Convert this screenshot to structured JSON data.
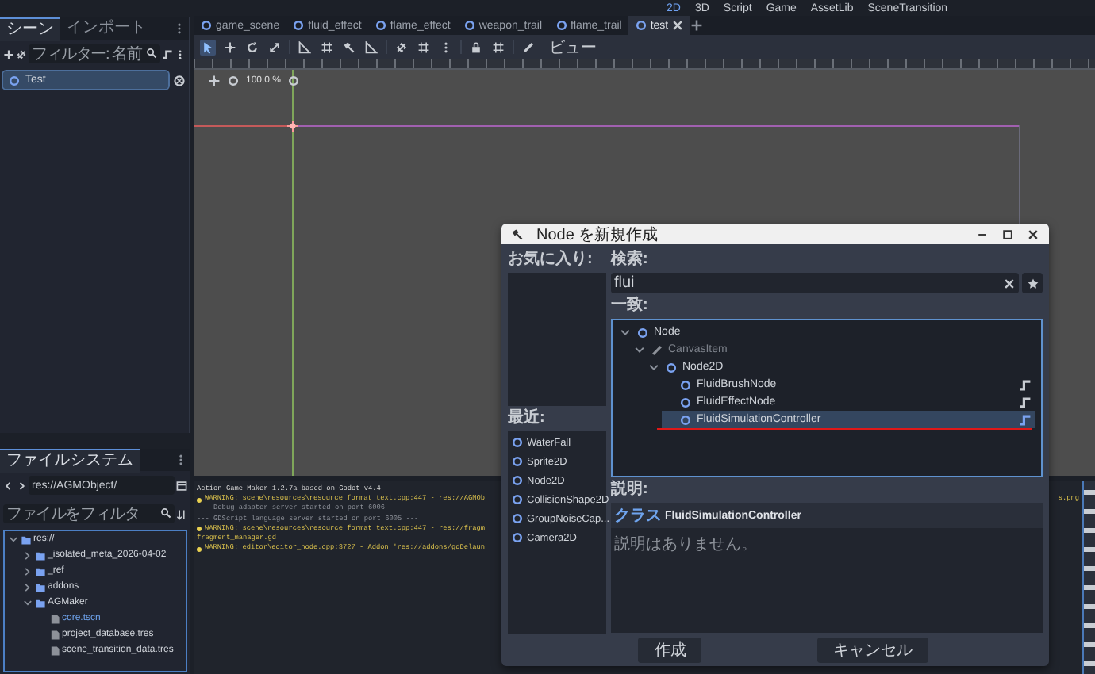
{
  "top_bar": {
    "workspaces": [
      {
        "label": "2D",
        "selected": true
      },
      {
        "label": "3D",
        "selected": false
      },
      {
        "label": "Script",
        "selected": false
      },
      {
        "label": "Game",
        "selected": false
      },
      {
        "label": "AssetLib",
        "selected": false
      },
      {
        "label": "SceneTransition",
        "selected": false
      }
    ]
  },
  "scene_dock": {
    "tabs": [
      {
        "label": "シーン",
        "selected": true
      },
      {
        "label": "インポート",
        "selected": false
      }
    ],
    "filter": {
      "placeholder": "フィルター: 名前"
    },
    "tree": [
      {
        "label": "Test",
        "selected": true
      }
    ]
  },
  "filesystem_dock": {
    "tab": "ファイルシステム",
    "path": "res://AGMObject/",
    "filter": {
      "placeholder": "ファイルをフィルタ"
    },
    "tree": [
      {
        "label": "res://",
        "kind": "folder",
        "expanded": true,
        "selected": false,
        "children": [
          {
            "label": "_isolated_meta_2026-04-02",
            "kind": "folder",
            "expanded": false,
            "selected": false
          },
          {
            "label": "_ref",
            "kind": "folder",
            "expanded": false,
            "selected": false
          },
          {
            "label": "addons",
            "kind": "folder",
            "expanded": false,
            "selected": false
          },
          {
            "label": "AGMaker",
            "kind": "folder",
            "expanded": true,
            "selected": false,
            "children": [
              {
                "label": "core.tscn",
                "kind": "file",
                "expanded": false,
                "selected": true
              },
              {
                "label": "project_database.tres",
                "kind": "file",
                "expanded": false,
                "selected": false
              },
              {
                "label": "scene_transition_data.tres",
                "kind": "file",
                "expanded": false,
                "selected": false
              }
            ]
          }
        ]
      }
    ]
  },
  "scene_tabs": [
    {
      "label": "game_scene",
      "selected": false
    },
    {
      "label": "fluid_effect",
      "selected": false
    },
    {
      "label": "flame_effect",
      "selected": false
    },
    {
      "label": "weapon_trail",
      "selected": false
    },
    {
      "label": "flame_trail",
      "selected": false
    },
    {
      "label": "test",
      "selected": true
    }
  ],
  "toolbar": {
    "tools": [
      {
        "selected": true
      },
      {
        "selected": false
      },
      {
        "selected": false
      },
      {
        "selected": false
      },
      {
        "selected": false
      },
      {
        "selected": false
      },
      {
        "selected": false
      },
      {
        "selected": false
      },
      {
        "selected": false
      },
      {
        "selected": false
      },
      {
        "selected": false
      },
      {
        "selected": false
      },
      {
        "selected": false
      },
      {
        "selected": false
      }
    ],
    "view_menu": "ビュー"
  },
  "viewport": {
    "zoom": "100.0 %"
  },
  "output": {
    "lines": [
      {
        "kind": "info",
        "text": "Action Game Maker 1.2.7a based on Godot v4.4"
      },
      {
        "kind": "warning",
        "text": "WARNING: scene\\resources\\resource_format_text.cpp:447 - res://AGMOb",
        "tail": "s.png"
      },
      {
        "kind": "dim",
        "text": "--- Debug adapter server started on port 6006 ---"
      },
      {
        "kind": "dim",
        "text": "--- GDScript language server started on port 6005 ---"
      },
      {
        "kind": "warning",
        "text": "WARNING: scene\\resources\\resource_format_text.cpp:447 - res://fragm"
      },
      {
        "kind": "plain",
        "text": "fragment_manager.gd"
      },
      {
        "kind": "warning",
        "text": "WARNING: editor\\editor_node.cpp:3727 - Addon 'res://addons/gdDelaun"
      }
    ]
  },
  "dialog": {
    "title": "Node を新規作成",
    "favorites_label": "お気に入り:",
    "recent_label": "最近:",
    "recent": [
      "WaterFall",
      "Sprite2D",
      "Node2D",
      "CollisionShape2D",
      "GroupNoiseCap...",
      "Camera2D"
    ],
    "search_label": "検索:",
    "search_value": "flui",
    "matches_label": "一致:",
    "matches": [
      {
        "label": "Node",
        "expanded": true,
        "disabled": false,
        "selected": false,
        "has_script": false,
        "children": [
          {
            "label": "CanvasItem",
            "expanded": true,
            "disabled": true,
            "selected": false,
            "has_script": false,
            "children": [
              {
                "label": "Node2D",
                "expanded": true,
                "disabled": false,
                "selected": false,
                "has_script": false,
                "children": [
                  {
                    "label": "FluidBrushNode",
                    "expanded": false,
                    "disabled": false,
                    "selected": false,
                    "has_script": true
                  },
                  {
                    "label": "FluidEffectNode",
                    "expanded": false,
                    "disabled": false,
                    "selected": false,
                    "has_script": true
                  },
                  {
                    "label": "FluidSimulationController",
                    "expanded": false,
                    "disabled": false,
                    "selected": true,
                    "has_script": true
                  }
                ]
              }
            ]
          }
        ]
      }
    ],
    "description_label": "説明:",
    "description_class": "クラス",
    "description_name": "FluidSimulationController",
    "description_text": "説明はありません。",
    "buttons": [
      "作成",
      "キャンセル"
    ]
  }
}
